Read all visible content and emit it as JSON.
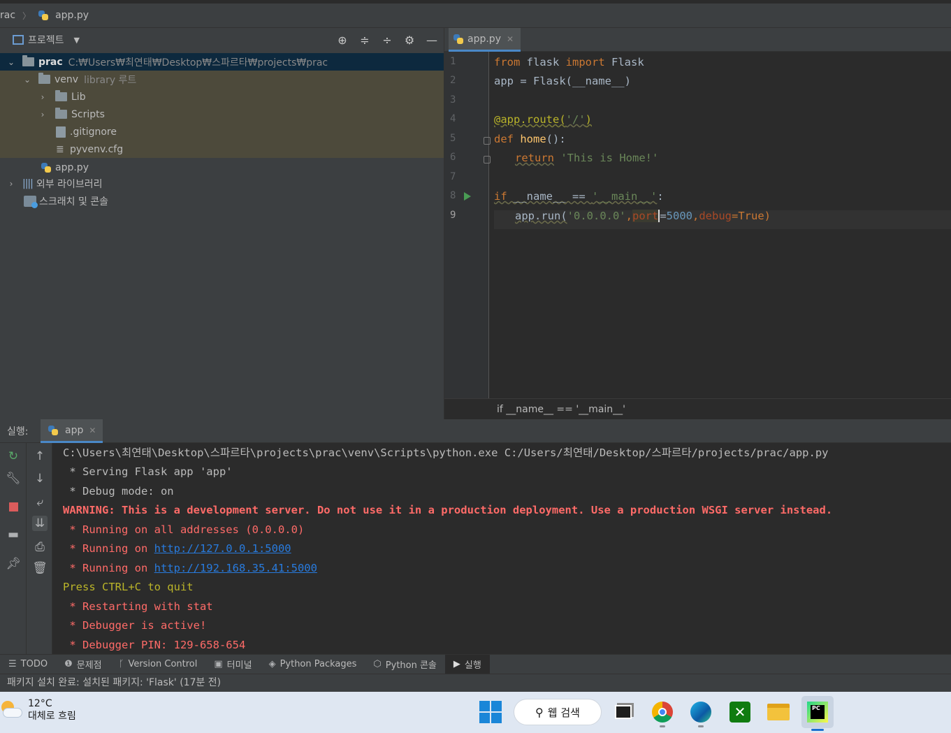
{
  "navbar": {
    "project": "rac",
    "file": "app.py"
  },
  "project_panel": {
    "title": "프로젝트",
    "tree": {
      "root_name": "prac",
      "root_path": "C:₩Users₩최연태₩Desktop₩스파르타₩projects₩prac",
      "venv_name": "venv",
      "venv_tag": "library 루트",
      "lib": "Lib",
      "scripts": "Scripts",
      "gitignore": ".gitignore",
      "pyvenv": "pyvenv.cfg",
      "app": "app.py",
      "external": "외부 라이브러리",
      "scratches": "스크래치 및 콘솔"
    }
  },
  "editor": {
    "tab_label": "app.py",
    "line_numbers": [
      "1",
      "2",
      "3",
      "4",
      "5",
      "6",
      "7",
      "8",
      "9"
    ],
    "lines": {
      "l1": {
        "a": "from",
        "b": " flask ",
        "c": "import",
        "d": " Flask"
      },
      "l2": {
        "a": "app = Flask(__name__)"
      },
      "l4": {
        "a": "@app.route(",
        "b": "'/'",
        "c": ")"
      },
      "l5": {
        "a": "def",
        "b": " ",
        "c": "home",
        "d": "():"
      },
      "l6": {
        "a": "return",
        "b": " ",
        "c": "'This is Home!'"
      },
      "l8": {
        "a": "if",
        "b": " __name__ == ",
        "c": "'__main__'",
        "d": ":"
      },
      "l9": {
        "a": "app.run(",
        "b": "'0.0.0.0'",
        "c": ",",
        "d": "port",
        "e": "=",
        "f": "5000",
        "g": ",",
        "h": "debug",
        "i": "=True)"
      }
    },
    "breadcrumb": "if __name__ == '__main__'"
  },
  "run_panel": {
    "label": "실행:",
    "tab": "app",
    "console": [
      "C:\\Users\\최연태\\Desktop\\스파르타\\projects\\prac\\venv\\Scripts\\python.exe C:/Users/최연태/Desktop/스파르타/projects/prac/app.py",
      " * Serving Flask app 'app'",
      " * Debug mode: on",
      "WARNING: This is a development server. Do not use it in a production deployment. Use a production WSGI server instead.",
      " * Running on all addresses (0.0.0.0)",
      " * Running on ",
      "http://127.0.0.1:5000",
      " * Running on ",
      "http://192.168.35.41:5000",
      "Press CTRL+C to quit",
      " * Restarting with stat",
      " * Debugger is active!",
      " * Debugger PIN: 129-658-654"
    ]
  },
  "tool_windows": [
    "TODO",
    "문제점",
    "Version Control",
    "터미널",
    "Python Packages",
    "Python 콘솔",
    "실행"
  ],
  "status": "패키지 설치 완료: 설치된 패키지: 'Flask' (17분 전)",
  "taskbar": {
    "temp": "12°C",
    "weather": "대체로 흐림",
    "search": "웹 검색"
  },
  "colors": {
    "accent": "#4a88c7",
    "link": "#287bde",
    "error": "#ff6b68",
    "keyword": "#cc7832"
  }
}
